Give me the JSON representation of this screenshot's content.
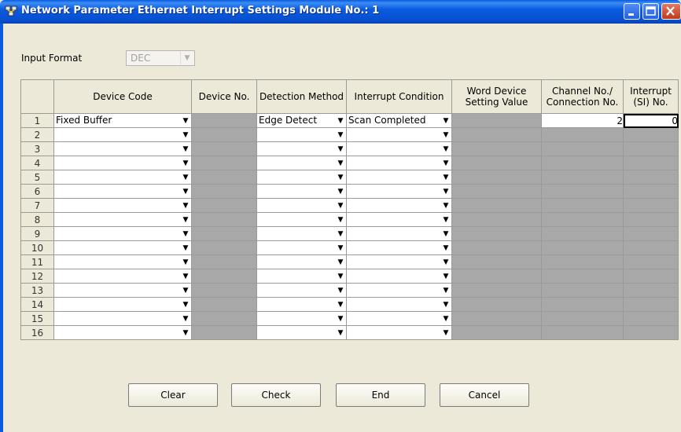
{
  "window": {
    "title": "Network Parameter  Ethernet Interrupt Settings Module No.: 1"
  },
  "input_format": {
    "label": "Input Format",
    "value": "DEC"
  },
  "table": {
    "headers": [
      "",
      "Device Code",
      "Device No.",
      "Detection Method",
      "Interrupt Condition",
      "Word Device Setting Value",
      "Channel No./ Connection No.",
      "Interrupt (SI) No."
    ],
    "rows": [
      {
        "num": "1",
        "device_code": "Fixed Buffer",
        "detection": "Edge Detect",
        "condition": "Scan Completed",
        "channel": "2",
        "si": "0"
      },
      {
        "num": "2",
        "device_code": "",
        "detection": "",
        "condition": "",
        "channel": "",
        "si": ""
      },
      {
        "num": "3",
        "device_code": "",
        "detection": "",
        "condition": "",
        "channel": "",
        "si": ""
      },
      {
        "num": "4",
        "device_code": "",
        "detection": "",
        "condition": "",
        "channel": "",
        "si": ""
      },
      {
        "num": "5",
        "device_code": "",
        "detection": "",
        "condition": "",
        "channel": "",
        "si": ""
      },
      {
        "num": "6",
        "device_code": "",
        "detection": "",
        "condition": "",
        "channel": "",
        "si": ""
      },
      {
        "num": "7",
        "device_code": "",
        "detection": "",
        "condition": "",
        "channel": "",
        "si": ""
      },
      {
        "num": "8",
        "device_code": "",
        "detection": "",
        "condition": "",
        "channel": "",
        "si": ""
      },
      {
        "num": "9",
        "device_code": "",
        "detection": "",
        "condition": "",
        "channel": "",
        "si": ""
      },
      {
        "num": "10",
        "device_code": "",
        "detection": "",
        "condition": "",
        "channel": "",
        "si": ""
      },
      {
        "num": "11",
        "device_code": "",
        "detection": "",
        "condition": "",
        "channel": "",
        "si": ""
      },
      {
        "num": "12",
        "device_code": "",
        "detection": "",
        "condition": "",
        "channel": "",
        "si": ""
      },
      {
        "num": "13",
        "device_code": "",
        "detection": "",
        "condition": "",
        "channel": "",
        "si": ""
      },
      {
        "num": "14",
        "device_code": "",
        "detection": "",
        "condition": "",
        "channel": "",
        "si": ""
      },
      {
        "num": "15",
        "device_code": "",
        "detection": "",
        "condition": "",
        "channel": "",
        "si": ""
      },
      {
        "num": "16",
        "device_code": "",
        "detection": "",
        "condition": "",
        "channel": "",
        "si": ""
      }
    ]
  },
  "buttons": {
    "clear": "Clear",
    "check": "Check",
    "end": "End",
    "cancel": "Cancel"
  },
  "icons": {
    "title": "network-icon",
    "dropdown": "dropdown-arrow-icon"
  }
}
